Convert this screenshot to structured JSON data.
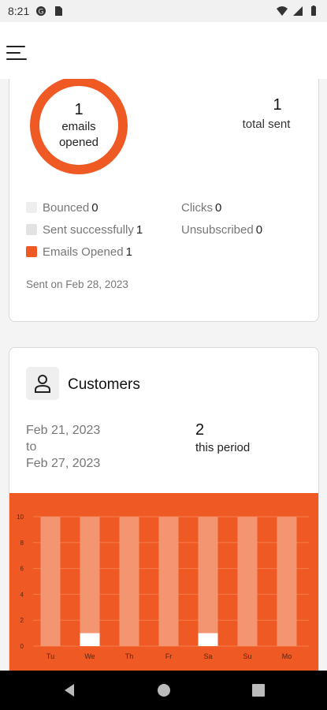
{
  "status_bar": {
    "time": "8:21"
  },
  "email_stats": {
    "opened_count": "1",
    "opened_label": "emails opened",
    "total_sent": "1",
    "total_sent_label": "total sent",
    "legend": [
      {
        "label": "Bounced",
        "value": "0",
        "color": "#eeeeee"
      },
      {
        "label": "Sent successfully",
        "value": "1",
        "color": "#e2e2e2"
      },
      {
        "label": "Emails Opened",
        "value": "1",
        "color": "#ef5a24"
      }
    ],
    "legend_right": [
      {
        "label": "Clicks",
        "value": "0"
      },
      {
        "label": "Unsubscribed",
        "value": "0"
      }
    ],
    "sent_on": "Sent on Feb 28, 2023"
  },
  "customers": {
    "title": "Customers",
    "date_from": "Feb 21, 2023",
    "date_to_word": "to",
    "date_to": "Feb 27, 2023",
    "count": "2",
    "count_label": "this period"
  },
  "colors": {
    "accent": "#ef5a24",
    "bar_track": "#f39570",
    "bar_fill": "#ffffff"
  },
  "chart_data": {
    "type": "bar",
    "categories": [
      "Tu",
      "We",
      "Th",
      "Fr",
      "Sa",
      "Su",
      "Mo"
    ],
    "values": [
      0,
      1,
      0,
      0,
      1,
      0,
      0
    ],
    "ylim": [
      0,
      10
    ],
    "yticks": [
      "0",
      "2",
      "4",
      "6",
      "8",
      "10"
    ],
    "grid": true
  },
  "nav": {
    "back_icon": "back-triangle-icon",
    "home_icon": "home-circle-icon",
    "recents_icon": "recents-square-icon"
  }
}
